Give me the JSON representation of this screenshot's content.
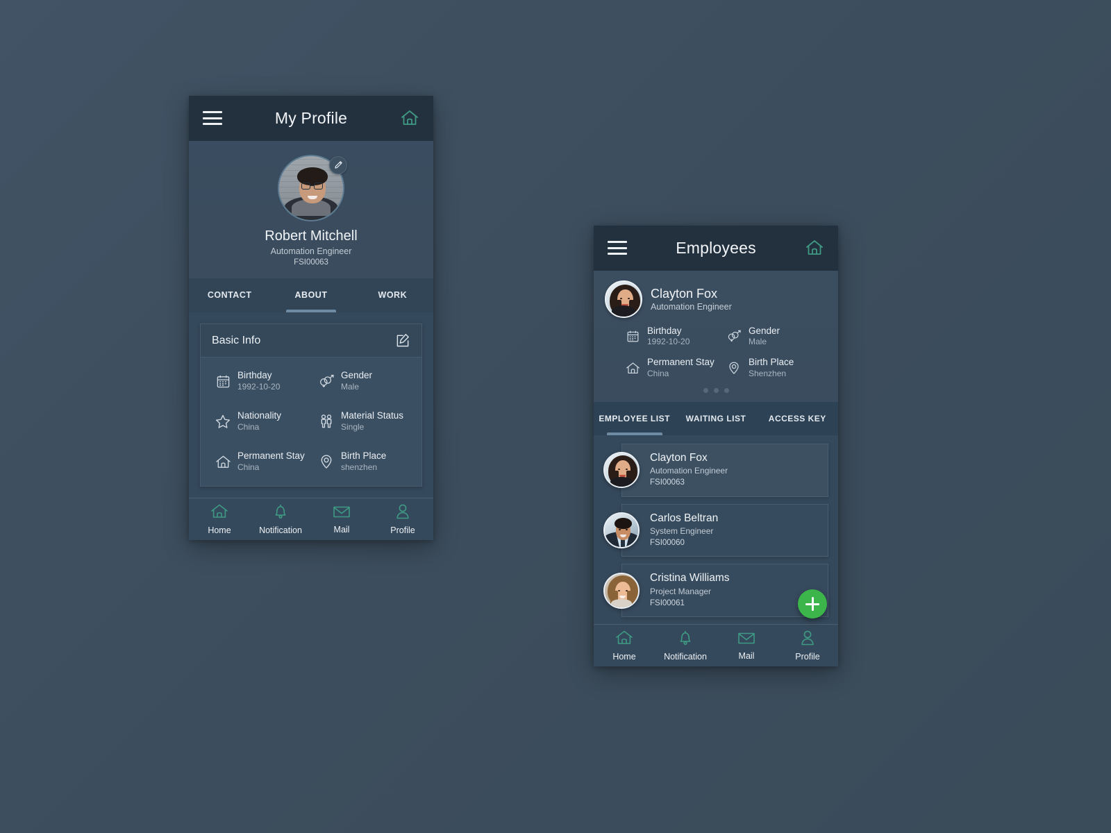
{
  "theme": {
    "page_bg": "#3d4f60",
    "appbar_bg": "#23303e",
    "surface": "#35495c",
    "card": "#3b4f62",
    "accent_teal": "#3f9a84",
    "accent_green": "#3cb54a",
    "text_primary": "#f1f4f7",
    "text_secondary": "#a9b6c2",
    "tab_indicator": "#6f8aa3"
  },
  "profile_screen": {
    "appbar": {
      "menu_icon": "hamburger-icon",
      "title": "My Profile",
      "home_icon": "home-icon"
    },
    "hero": {
      "avatar": "avatar-robert-mitchell",
      "edit_icon": "pencil-icon",
      "name": "Robert Mitchell",
      "role": "Automation Engineer",
      "employee_id": "FSI00063"
    },
    "tabs": [
      {
        "label": "CONTACT",
        "active": false
      },
      {
        "label": "ABOUT",
        "active": true
      },
      {
        "label": "WORK",
        "active": false
      }
    ],
    "basic_info": {
      "title": "Basic Info",
      "edit_icon": "edit-square-icon",
      "fields": [
        {
          "icon": "calendar-icon",
          "label": "Birthday",
          "value": "1992-10-20"
        },
        {
          "icon": "gender-icon",
          "label": "Gender",
          "value": "Male"
        },
        {
          "icon": "star-icon",
          "label": "Nationality",
          "value": "China"
        },
        {
          "icon": "people-icon",
          "label": "Material Status",
          "value": "Single"
        },
        {
          "icon": "home-outline-icon",
          "label": "Permanent Stay",
          "value": "China"
        },
        {
          "icon": "location-pin-icon",
          "label": "Birth Place",
          "value": "shenzhen"
        }
      ]
    },
    "bottom_nav": [
      {
        "icon": "home-icon",
        "label": "Home"
      },
      {
        "icon": "bell-icon",
        "label": "Notification"
      },
      {
        "icon": "envelope-icon",
        "label": "Mail"
      },
      {
        "icon": "person-icon",
        "label": "Profile"
      }
    ]
  },
  "employees_screen": {
    "appbar": {
      "menu_icon": "hamburger-icon",
      "title": "Employees",
      "home_icon": "home-icon"
    },
    "featured": {
      "avatar": "avatar-clayton-fox",
      "name": "Clayton Fox",
      "role": "Automation Engineer",
      "fields": [
        {
          "icon": "calendar-icon",
          "label": "Birthday",
          "value": "1992-10-20"
        },
        {
          "icon": "gender-icon",
          "label": "Gender",
          "value": "Male"
        },
        {
          "icon": "home-outline-icon",
          "label": "Permanent Stay",
          "value": "China"
        },
        {
          "icon": "location-pin-icon",
          "label": "Birth Place",
          "value": "Shenzhen"
        }
      ],
      "pagination_dots": 3,
      "active_dot_index": 0
    },
    "tabs": [
      {
        "label": "EMPLOYEE LIST",
        "active": true
      },
      {
        "label": "WAITING LIST",
        "active": false
      },
      {
        "label": "ACCESS KEY",
        "active": false
      }
    ],
    "list": [
      {
        "avatar": "avatar-clayton-fox",
        "name": "Clayton Fox",
        "role": "Automation Engineer",
        "employee_id": "FSI00063",
        "selected": true
      },
      {
        "avatar": "avatar-carlos-beltran",
        "name": "Carlos Beltran",
        "role": "System Engineer",
        "employee_id": "FSI00060",
        "selected": false
      },
      {
        "avatar": "avatar-cristina-williams",
        "name": "Cristina Williams",
        "role": "Project Manager",
        "employee_id": "FSI00061",
        "selected": false
      }
    ],
    "fab": {
      "icon": "plus-icon",
      "label": ""
    },
    "bottom_nav": [
      {
        "icon": "home-icon",
        "label": "Home"
      },
      {
        "icon": "bell-icon",
        "label": "Notification"
      },
      {
        "icon": "envelope-icon",
        "label": "Mail"
      },
      {
        "icon": "person-icon",
        "label": "Profile"
      }
    ]
  }
}
